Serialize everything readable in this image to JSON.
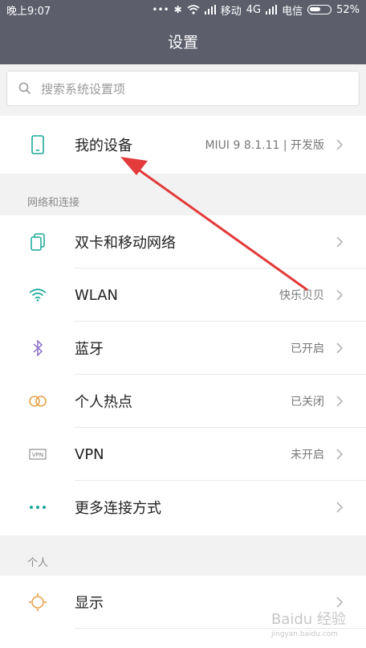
{
  "status": {
    "time": "晚上9:07",
    "carrier1": "移动",
    "net": "4G",
    "carrier2": "电信",
    "battery": "52%",
    "battery_level": 0.52
  },
  "header": {
    "title": "设置"
  },
  "search": {
    "placeholder": "搜索系统设置项"
  },
  "device": {
    "label": "我的设备",
    "value": "MIUI 9 8.1.11 | 开发版"
  },
  "sections": {
    "network": "网络和连接",
    "personal": "个人"
  },
  "network_items": [
    {
      "label": "双卡和移动网络",
      "value": "",
      "icon": "dual-sim-icon"
    },
    {
      "label": "WLAN",
      "value": "快乐贝贝",
      "icon": "wifi-icon"
    },
    {
      "label": "蓝牙",
      "value": "已开启",
      "icon": "bluetooth-icon"
    },
    {
      "label": "个人热点",
      "value": "已关闭",
      "icon": "hotspot-icon"
    },
    {
      "label": "VPN",
      "value": "未开启",
      "icon": "vpn-icon"
    },
    {
      "label": "更多连接方式",
      "value": "",
      "icon": "more-dots-icon"
    }
  ],
  "personal_items": [
    {
      "label": "显示",
      "value": "",
      "icon": "brightness-icon"
    }
  ],
  "watermark": {
    "main": "Baidu 经验",
    "sub": "jingyan.baidu.com"
  },
  "colors": {
    "header_bg": "#5c5e6c",
    "accent_teal": "#1aa89a",
    "arrow_red": "#e33b3b"
  }
}
